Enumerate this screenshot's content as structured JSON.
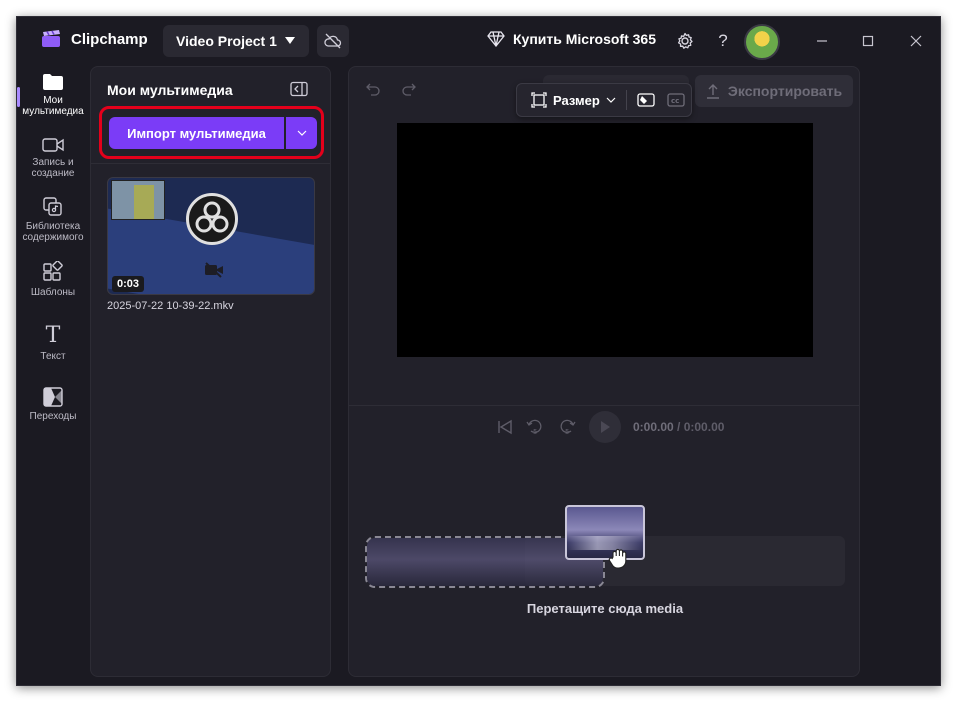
{
  "app": {
    "name": "Clipchamp"
  },
  "titlebar": {
    "project_name": "Video Project 1",
    "buy_label": "Купить Microsoft 365",
    "icons": [
      "cloud-off-icon",
      "diamond-icon",
      "gear-icon",
      "help-icon",
      "minimize-icon",
      "maximize-icon",
      "close-icon"
    ]
  },
  "rail": {
    "items": [
      {
        "label": "Мои мультимедиа",
        "icon": "folder-icon"
      },
      {
        "label": "Запись и создание",
        "icon": "camera-icon"
      },
      {
        "label": "Библиотека содержимого",
        "icon": "library-icon"
      },
      {
        "label": "Шаблоны",
        "icon": "templates-icon"
      },
      {
        "label": "Текст",
        "icon": "text-icon"
      },
      {
        "label": "Переходы",
        "icon": "transitions-icon"
      }
    ]
  },
  "media_panel": {
    "title": "Мои мультимедиа",
    "import_label": "Импорт мультимедиа",
    "items": [
      {
        "duration": "0:03",
        "filename": "2025-07-22 10-39-22.mkv"
      }
    ]
  },
  "preview": {
    "export_label": "Экспортировать",
    "size_label": "Размер",
    "time_current": "0:00.00",
    "time_total": "/ 0:00.00",
    "drop_label": "Перетащите сюда media"
  },
  "colors": {
    "accent": "#7b3cf7",
    "highlight": "#e4001b",
    "background": "#1b1a22",
    "panel": "#22212a"
  }
}
